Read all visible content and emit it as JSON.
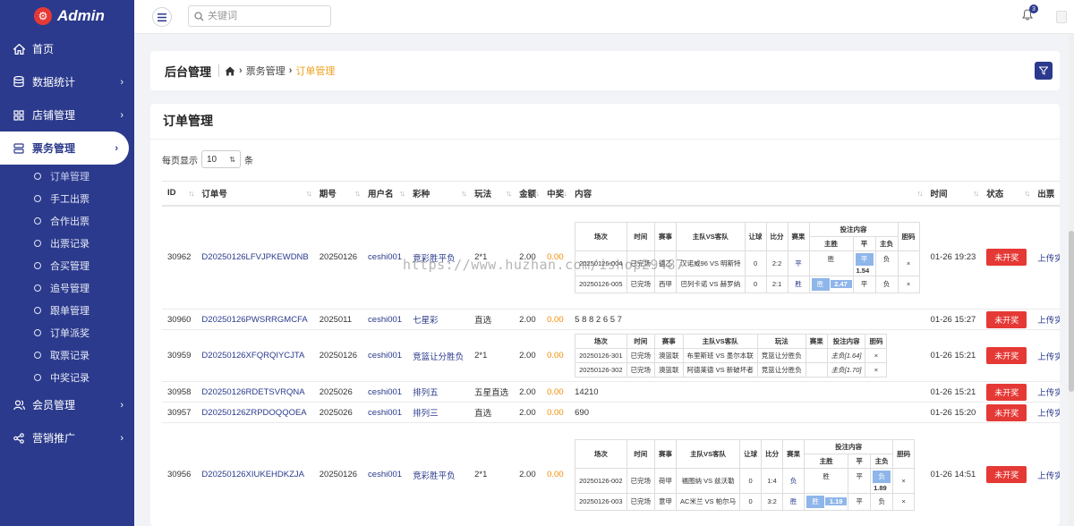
{
  "app": {
    "brand": "Admin",
    "logo_char": "⚙"
  },
  "sidebar": {
    "items": [
      {
        "label": "首页",
        "icon": "home-icon",
        "has_arrow": false
      },
      {
        "label": "数据统计",
        "icon": "database-icon",
        "has_arrow": true
      },
      {
        "label": "店铺管理",
        "icon": "grid-icon",
        "has_arrow": true
      },
      {
        "label": "票务管理",
        "icon": "server-icon",
        "has_arrow": true,
        "active": true
      },
      {
        "label": "会员管理",
        "icon": "users-icon",
        "has_arrow": true
      },
      {
        "label": "营销推广",
        "icon": "share-icon",
        "has_arrow": true
      }
    ],
    "sub_items": [
      "订单管理",
      "手工出票",
      "合作出票",
      "出票记录",
      "合买管理",
      "追号管理",
      "跟单管理",
      "订单派奖",
      "取票记录",
      "中奖记录"
    ]
  },
  "topbar": {
    "search_placeholder": "关键词",
    "notification_count": "3"
  },
  "header": {
    "title": "后台管理",
    "breadcrumb": [
      "票务管理",
      "订单管理"
    ]
  },
  "card": {
    "title": "订单管理",
    "page_size_prefix": "每页显示",
    "page_size_value": "10",
    "page_size_suffix": "条"
  },
  "table": {
    "columns": [
      "ID",
      "订单号",
      "期号",
      "用户名",
      "彩种",
      "玩法",
      "金额",
      "中奖",
      "内容",
      "时间",
      "状态",
      "出票"
    ],
    "rows": [
      {
        "id": "30962",
        "order": "D20250126LFVJPKEWDNB",
        "issue": "20250126",
        "user": "ceshi001",
        "lottery": "竞彩胜平负",
        "play": "2*1",
        "amount": "2.00",
        "win": "0.00",
        "time": "01-26 19:23",
        "status": "未开奖",
        "ticket": "上传实票"
      },
      {
        "id": "30960",
        "order": "D20250126PWSRRGMCFA",
        "issue": "2025011",
        "user": "ceshi001",
        "lottery": "七星彩",
        "play": "直选",
        "amount": "2.00",
        "win": "0.00",
        "content": "5 8 8 2 6 5 7",
        "time": "01-26 15:27",
        "status": "未开奖",
        "ticket": "上传实票"
      },
      {
        "id": "30959",
        "order": "D20250126XFQRQIYCJTA",
        "issue": "20250126",
        "user": "ceshi001",
        "lottery": "竞篮让分胜负",
        "play": "2*1",
        "amount": "2.00",
        "win": "0.00",
        "time": "01-26 15:21",
        "status": "未开奖",
        "ticket": "上传实票"
      },
      {
        "id": "30958",
        "order": "D20250126RDETSVRQNA",
        "issue": "2025026",
        "user": "ceshi001",
        "lottery": "排列五",
        "play": "五星直选",
        "amount": "2.00",
        "win": "0.00",
        "content": "14210",
        "time": "01-26 15:21",
        "status": "未开奖",
        "ticket": "上传实票"
      },
      {
        "id": "30957",
        "order": "D20250126ZRPDOQQOEA",
        "issue": "2025026",
        "user": "ceshi001",
        "lottery": "排列三",
        "play": "直选",
        "amount": "2.00",
        "win": "0.00",
        "content": "690",
        "time": "01-26 15:20",
        "status": "未开奖",
        "ticket": "上传实票"
      },
      {
        "id": "30956",
        "order": "D20250126XIUKEHDKZJA",
        "issue": "20250126",
        "user": "ceshi001",
        "lottery": "竞彩胜平负",
        "play": "2*1",
        "amount": "2.00",
        "win": "0.00",
        "time": "01-26 14:51",
        "status": "未开奖",
        "ticket": "上传实票"
      }
    ],
    "soccer_headers": [
      "场次",
      "时间",
      "赛事",
      "主队VS客队",
      "让球",
      "比分",
      "赛果",
      "投注内容",
      "胆码"
    ],
    "bet_headers": [
      "主胜",
      "平",
      "主负"
    ],
    "row1_matches": [
      {
        "match": "20250126-004",
        "time": "已完场",
        "league": "德乙",
        "teams": "汉诺威96 VS 明斯特",
        "handicap": "0",
        "score": "2:2",
        "result": "平",
        "bets": [
          "胜",
          "平",
          "负"
        ],
        "hl": 1,
        "odds": "1.54",
        "banker": "×"
      },
      {
        "match": "20250126-005",
        "time": "已完场",
        "league": "西甲",
        "teams": "巴列卡诺 VS 赫罗纳",
        "handicap": "0",
        "score": "2:1",
        "result": "胜",
        "bets": [
          "胜",
          "平",
          "负"
        ],
        "hl": 0,
        "odds": "2.47",
        "banker": "×"
      }
    ],
    "basket_headers": [
      "场次",
      "时间",
      "赛事",
      "主队VS客队",
      "玩法",
      "赛果",
      "投注内容",
      "胆码"
    ],
    "row3_matches": [
      {
        "match": "20250126-301",
        "time": "已完场",
        "league": "澳篮联",
        "teams": "布里斯班 VS 墨尔本联",
        "play": "竞篮让分胜负",
        "result": "",
        "bet": "主负[1.64]",
        "banker": "×"
      },
      {
        "match": "20250126-302",
        "time": "已完场",
        "league": "澳篮联",
        "teams": "阿德莱德 VS 新破坏者",
        "play": "竞篮让分胜负",
        "result": "",
        "bet": "主负[1.70]",
        "banker": "×"
      }
    ],
    "row6_matches": [
      {
        "match": "20250126-002",
        "time": "已完场",
        "league": "荷甲",
        "teams": "福图纳 VS 兹沃勒",
        "handicap": "0",
        "score": "1:4",
        "result": "负",
        "bets": [
          "胜",
          "平",
          "负"
        ],
        "hl": 2,
        "odds": "1.89",
        "banker": "×"
      },
      {
        "match": "20250126-003",
        "time": "已完场",
        "league": "意甲",
        "teams": "AC米兰 VS 帕尔马",
        "handicap": "0",
        "score": "3:2",
        "result": "胜",
        "bets": [
          "胜",
          "平",
          "负"
        ],
        "hl": 0,
        "odds": "1.19",
        "banker": "×"
      }
    ]
  },
  "watermark": "https://www.huzhan.com/ishop29487",
  "colors": {
    "sidebar_bg": "#2b3a8c",
    "accent_orange": "#f08c00",
    "status_red": "#e53935",
    "bet_highlight": "#8fb6ea"
  }
}
